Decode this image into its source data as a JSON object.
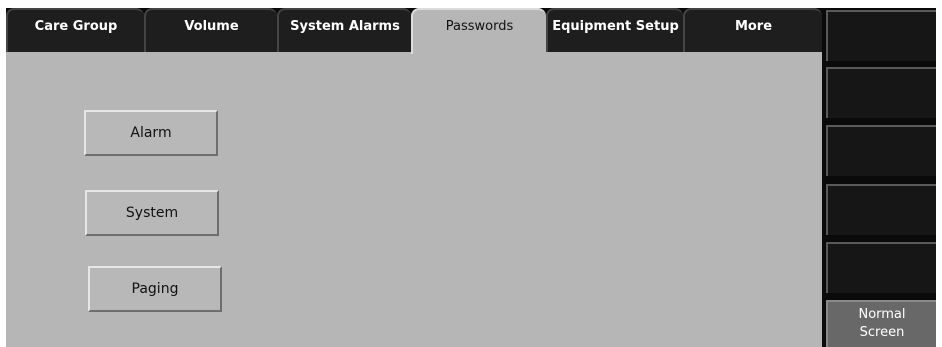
{
  "tabs": [
    {
      "label": "Care Group",
      "active": false
    },
    {
      "label": "Volume",
      "active": false
    },
    {
      "label": "System Alarms",
      "active": false
    },
    {
      "label": "Passwords",
      "active": true
    },
    {
      "label": "Equipment Setup",
      "active": false
    },
    {
      "label": "More",
      "active": false
    }
  ],
  "passwords": {
    "buttons": [
      {
        "label": "Alarm"
      },
      {
        "label": "System"
      },
      {
        "label": "Paging"
      }
    ]
  },
  "side_panel": {
    "normal_screen_line1": "Normal",
    "normal_screen_line2": "Screen"
  },
  "colors": {
    "background": "#0a0a0a",
    "panel": "#b6b6b6",
    "active_tab": "#b6b6b6",
    "inactive_tab": "#1e1e1e",
    "normal_screen_button": "#686868"
  }
}
